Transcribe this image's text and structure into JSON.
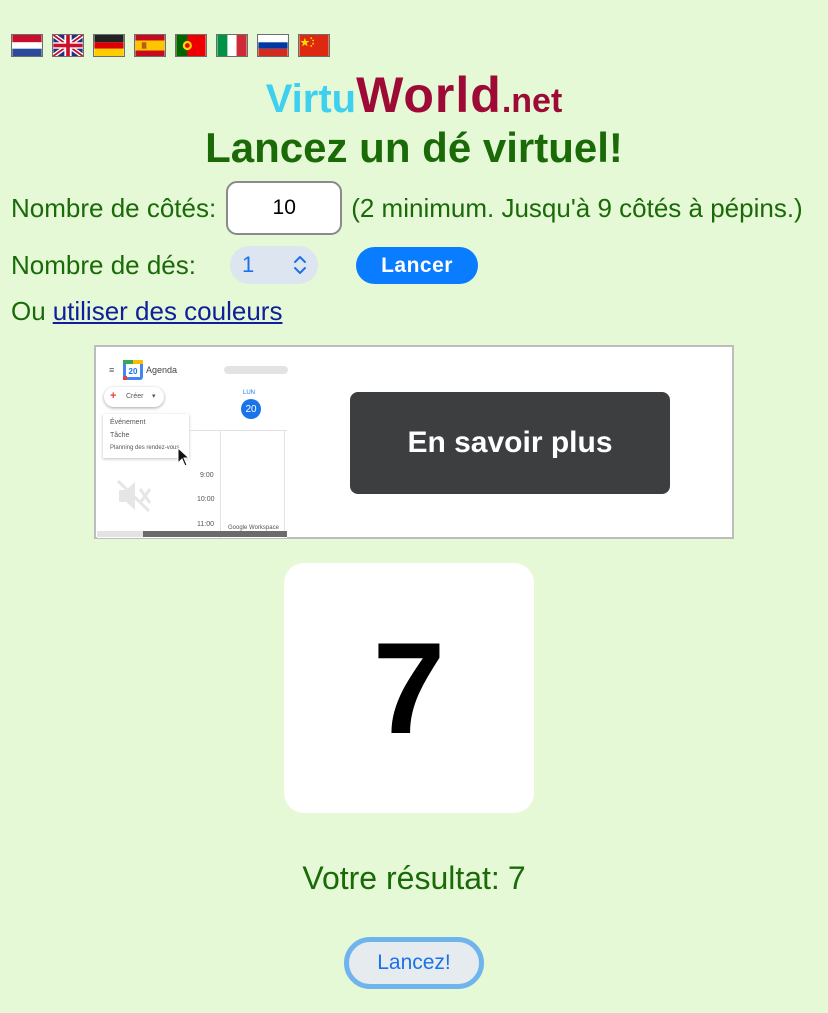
{
  "languages": [
    {
      "code": "nl",
      "name": "Nederlands"
    },
    {
      "code": "en",
      "name": "English"
    },
    {
      "code": "de",
      "name": "Deutsch"
    },
    {
      "code": "es",
      "name": "Español"
    },
    {
      "code": "pt",
      "name": "Português"
    },
    {
      "code": "it",
      "name": "Italiano"
    },
    {
      "code": "ru",
      "name": "Русский"
    },
    {
      "code": "zh",
      "name": "中文"
    }
  ],
  "logo": {
    "part1": "Virtu",
    "part2": "World",
    "part3": ".net"
  },
  "title": "Lancez un dé virtuel!",
  "sides": {
    "label": "Nombre de côtés:",
    "value": "10",
    "note": "(2 minimum. Jusqu'à 9 côtés à pépins.)"
  },
  "dice": {
    "label": "Nombre de dés:",
    "value": "1"
  },
  "roll_button": "Lancer",
  "colors": {
    "prefix": "Ou",
    "link": "utiliser des couleurs"
  },
  "ad": {
    "cta": "En savoir plus",
    "app_name": "Agenda",
    "create": "Créer",
    "menu": [
      "Événement",
      "Tâche",
      "Planning des rendez-vous"
    ],
    "day_label": "LUN",
    "day_number": "20",
    "times": [
      "9:00",
      "10:00",
      "11:00"
    ],
    "brand": "Google Workspace"
  },
  "die_face": "7",
  "result": {
    "label": "Votre résultat:",
    "value": "7"
  },
  "again_button": "Lancez!",
  "colors_palette": {
    "background": "#e5f9d6",
    "text": "#1a6a08",
    "accent": "#0a7cff"
  }
}
